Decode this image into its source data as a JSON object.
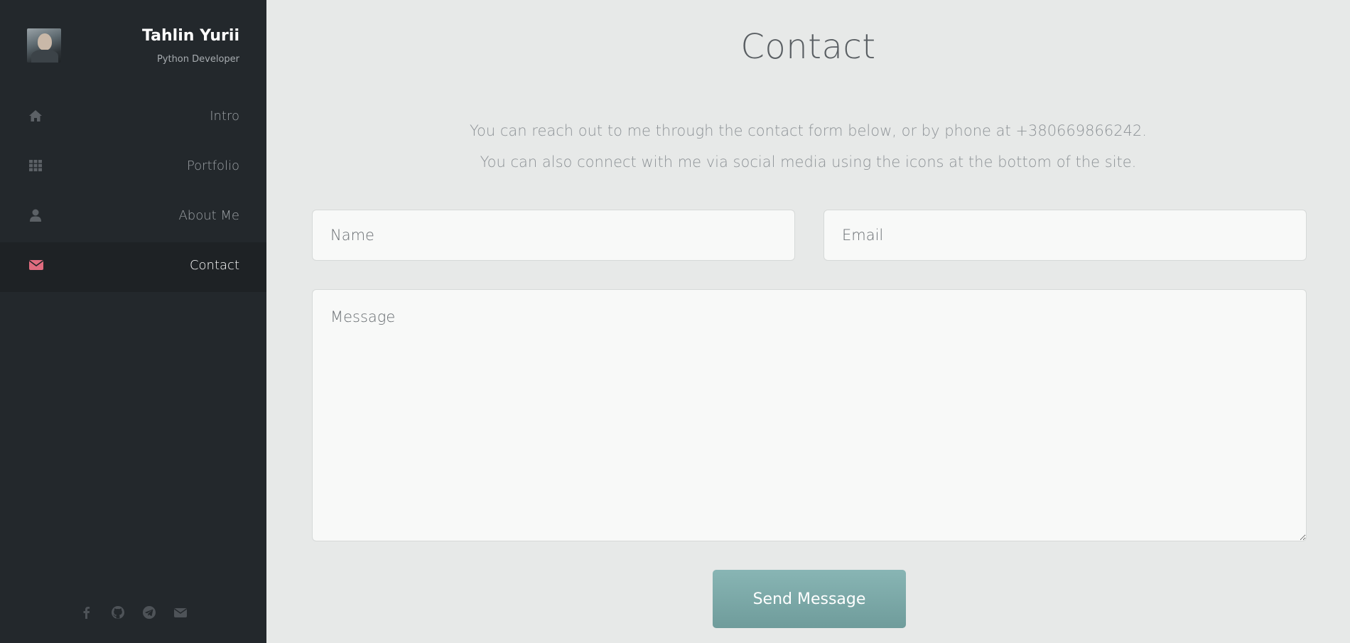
{
  "profile": {
    "name": "Tahlin Yurii",
    "role": "Python Developer"
  },
  "nav": {
    "items": [
      {
        "label": "Intro",
        "icon": "home-icon"
      },
      {
        "label": "Portfolio",
        "icon": "grid-icon"
      },
      {
        "label": "About Me",
        "icon": "user-icon"
      },
      {
        "label": "Contact",
        "icon": "envelope-icon",
        "active": true
      }
    ]
  },
  "social": [
    "facebook-icon",
    "github-icon",
    "telegram-icon",
    "envelope-icon"
  ],
  "main": {
    "title": "Contact",
    "intro_line1": "You can reach out to me through the contact form below, or by phone at +380669866242.",
    "intro_line2": "You can also connect with me via social media using the icons at the bottom of the site.",
    "form": {
      "name_placeholder": "Name",
      "email_placeholder": "Email",
      "message_placeholder": "Message",
      "send_label": "Send Message"
    }
  },
  "colors": {
    "sidebar_bg": "#23282c",
    "active_bg": "#1e2225",
    "accent_pink": "#e06c7f",
    "button": "#7eabaa",
    "page_bg": "#e7e9e8"
  }
}
